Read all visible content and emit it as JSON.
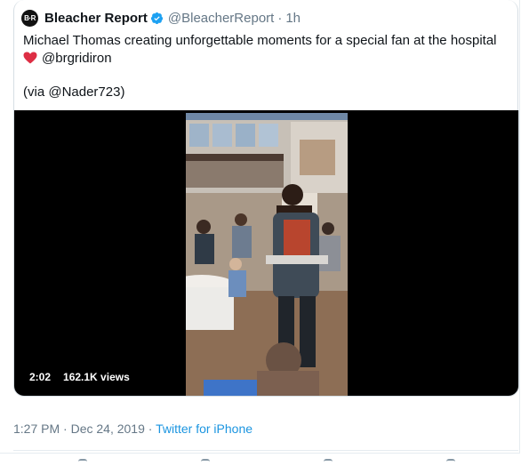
{
  "tweet": {
    "author": {
      "avatar_text": "B·R",
      "display_name": "Bleacher Report",
      "handle": "@BleacherReport",
      "time_ago": "1h",
      "verified": true
    },
    "text": {
      "line1": "Michael Thomas creating unforgettable moments for a special fan at the hospital",
      "line2": "@brgridiron",
      "line3": "(via @Nader723)"
    },
    "media": {
      "type": "video",
      "duration": "2:02",
      "views": "162.1K views"
    },
    "footer": {
      "timestamp": "1:27 PM · Dec 24, 2019",
      "separator": "·",
      "source": "Twitter for iPhone"
    }
  },
  "colors": {
    "text_primary": "#0f1419",
    "text_secondary": "#657786",
    "link": "#1b95e0",
    "verified": "#1da1f2",
    "heart": "#e0245e"
  },
  "icons": [
    "verified-badge-icon",
    "heart-emoji-icon"
  ]
}
